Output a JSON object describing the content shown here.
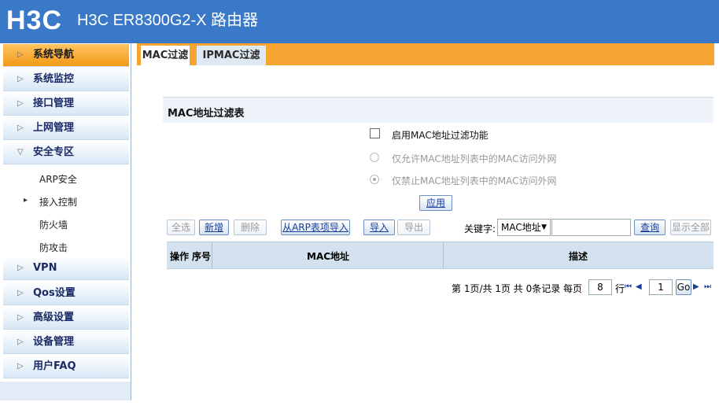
{
  "header": {
    "logo": "H3C",
    "title": "H3C ER8300G2-X 路由器"
  },
  "sidebar": {
    "items": [
      {
        "label": "系统导航",
        "arrow": "▷"
      },
      {
        "label": "系统监控",
        "arrow": "▷"
      },
      {
        "label": "接口管理",
        "arrow": "▷"
      },
      {
        "label": "上网管理",
        "arrow": "▷"
      },
      {
        "label": "安全专区",
        "arrow": "▽"
      },
      {
        "label": "VPN",
        "arrow": "▷"
      },
      {
        "label": "Qos设置",
        "arrow": "▷"
      },
      {
        "label": "高级设置",
        "arrow": "▷"
      },
      {
        "label": "设备管理",
        "arrow": "▷"
      },
      {
        "label": "用户FAQ",
        "arrow": "▷"
      }
    ],
    "sub_items": [
      {
        "label": "ARP安全"
      },
      {
        "label": "接入控制",
        "arrow": "▸"
      },
      {
        "label": "防火墙"
      },
      {
        "label": "防攻击"
      }
    ]
  },
  "tabs": [
    {
      "label": "MAC过滤"
    },
    {
      "label": "IPMAC过滤"
    }
  ],
  "panel": {
    "title": "MAC地址过滤表",
    "enable_label": "启用MAC地址过滤功能",
    "allow_label": "仅允许MAC地址列表中的MAC访问外网",
    "deny_label": "仅禁止MAC地址列表中的MAC访问外网",
    "apply_label": "应用"
  },
  "toolbar": {
    "select_all": "全选",
    "add": "新增",
    "delete": "删除",
    "import_arp": "从ARP表项导入",
    "import": "导入",
    "export": "导出",
    "keyword_label": "关键字:",
    "keyword_value": "MAC地址",
    "search": "查询",
    "show_all": "显示全部"
  },
  "table": {
    "columns": [
      "操作",
      "序号",
      "MAC地址",
      "描述"
    ]
  },
  "pager": {
    "text": "第 1页/共 1页 共 0条记录 每页",
    "per_page": "8",
    "rows_label": "行",
    "page": "1",
    "go": "Go"
  }
}
